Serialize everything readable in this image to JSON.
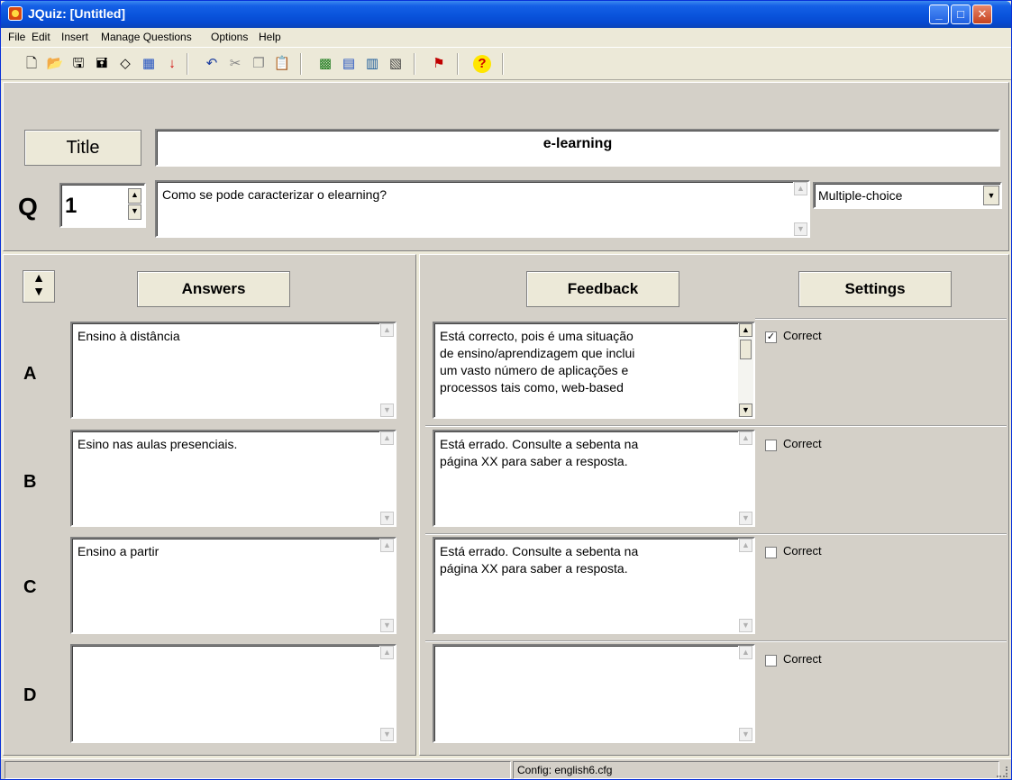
{
  "window": {
    "title": "JQuiz: [Untitled]"
  },
  "menu": [
    "File",
    "Edit",
    "Insert",
    "Manage Questions",
    "Options",
    "Help"
  ],
  "toolbar_icons": [
    "new-file-icon",
    "open-folder-icon",
    "save-icon",
    "save-as-icon",
    "eraser-icon",
    "web-page-icon",
    "down-arrow-icon",
    "undo-icon",
    "cut-icon",
    "copy-icon",
    "paste-icon",
    "web-export-icon",
    "ftp-upload-icon",
    "export-icon",
    "printer-export-icon",
    "flag-icon",
    "help-icon"
  ],
  "header": {
    "title_label": "Title",
    "title_value": "e-learning",
    "q_label": "Q",
    "question_number": "1",
    "question_text": "Como se pode caracterizar o elearning?",
    "question_type": "Multiple-choice"
  },
  "columns": {
    "answers": "Answers",
    "feedback": "Feedback",
    "settings": "Settings"
  },
  "rows": [
    {
      "letter": "A",
      "answer": "Ensino à distância",
      "feedback": "Está correcto, pois é uma situação\nde ensino/aprendizagem que inclui\num vasto número de aplicações e\nprocessos tais como, web-based",
      "correct_label": "Correct",
      "correct": true
    },
    {
      "letter": "B",
      "answer": "Esino nas aulas presenciais.",
      "feedback": "Está errado. Consulte a sebenta na\npágina XX para saber a resposta.",
      "correct_label": "Correct",
      "correct": false
    },
    {
      "letter": "C",
      "answer": "Ensino a partir",
      "feedback": "Está errado. Consulte a sebenta na\npágina XX para saber a resposta.",
      "correct_label": "Correct",
      "correct": false
    },
    {
      "letter": "D",
      "answer": "",
      "feedback": "",
      "correct_label": "Correct",
      "correct": false
    }
  ],
  "status": {
    "config": "Config: english6.cfg"
  }
}
